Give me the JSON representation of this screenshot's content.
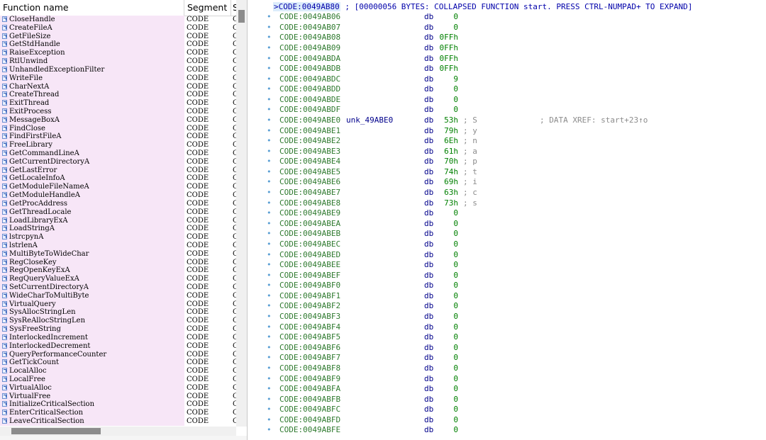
{
  "functions_window": {
    "columns": [
      "Function name",
      "Segment",
      "S"
    ],
    "rows": [
      {
        "name": "CloseHandle",
        "segment": "CODE",
        "extra": "C"
      },
      {
        "name": "CreateFileA",
        "segment": "CODE",
        "extra": "C"
      },
      {
        "name": "GetFileSize",
        "segment": "CODE",
        "extra": "C"
      },
      {
        "name": "GetStdHandle",
        "segment": "CODE",
        "extra": "C"
      },
      {
        "name": "RaiseException",
        "segment": "CODE",
        "extra": "C"
      },
      {
        "name": "RtlUnwind",
        "segment": "CODE",
        "extra": "C"
      },
      {
        "name": "UnhandledExceptionFilter",
        "segment": "CODE",
        "extra": "C"
      },
      {
        "name": "WriteFile",
        "segment": "CODE",
        "extra": "C"
      },
      {
        "name": "CharNextA",
        "segment": "CODE",
        "extra": "C"
      },
      {
        "name": "CreateThread",
        "segment": "CODE",
        "extra": "C"
      },
      {
        "name": "ExitThread",
        "segment": "CODE",
        "extra": "C"
      },
      {
        "name": "ExitProcess",
        "segment": "CODE",
        "extra": "C"
      },
      {
        "name": "MessageBoxA",
        "segment": "CODE",
        "extra": "C"
      },
      {
        "name": "FindClose",
        "segment": "CODE",
        "extra": "C"
      },
      {
        "name": "FindFirstFileA",
        "segment": "CODE",
        "extra": "C"
      },
      {
        "name": "FreeLibrary",
        "segment": "CODE",
        "extra": "C"
      },
      {
        "name": "GetCommandLineA",
        "segment": "CODE",
        "extra": "C"
      },
      {
        "name": "GetCurrentDirectoryA",
        "segment": "CODE",
        "extra": "C"
      },
      {
        "name": "GetLastError",
        "segment": "CODE",
        "extra": "C"
      },
      {
        "name": "GetLocaleInfoA",
        "segment": "CODE",
        "extra": "C"
      },
      {
        "name": "GetModuleFileNameA",
        "segment": "CODE",
        "extra": "C"
      },
      {
        "name": "GetModuleHandleA",
        "segment": "CODE",
        "extra": "C"
      },
      {
        "name": "GetProcAddress",
        "segment": "CODE",
        "extra": "C"
      },
      {
        "name": "GetThreadLocale",
        "segment": "CODE",
        "extra": "C"
      },
      {
        "name": "LoadLibraryExA",
        "segment": "CODE",
        "extra": "C"
      },
      {
        "name": "LoadStringA",
        "segment": "CODE",
        "extra": "C"
      },
      {
        "name": "lstrcpynA",
        "segment": "CODE",
        "extra": "C"
      },
      {
        "name": "lstrlenA",
        "segment": "CODE",
        "extra": "C"
      },
      {
        "name": "MultiByteToWideChar",
        "segment": "CODE",
        "extra": "C"
      },
      {
        "name": "RegCloseKey",
        "segment": "CODE",
        "extra": "C"
      },
      {
        "name": "RegOpenKeyExA",
        "segment": "CODE",
        "extra": "C"
      },
      {
        "name": "RegQueryValueExA",
        "segment": "CODE",
        "extra": "C"
      },
      {
        "name": "SetCurrentDirectoryA",
        "segment": "CODE",
        "extra": "C"
      },
      {
        "name": "WideCharToMultiByte",
        "segment": "CODE",
        "extra": "C"
      },
      {
        "name": "VirtualQuery",
        "segment": "CODE",
        "extra": "C"
      },
      {
        "name": "SysAllocStringLen",
        "segment": "CODE",
        "extra": "C"
      },
      {
        "name": "SysReAllocStringLen",
        "segment": "CODE",
        "extra": "C"
      },
      {
        "name": "SysFreeString",
        "segment": "CODE",
        "extra": "C"
      },
      {
        "name": "InterlockedIncrement",
        "segment": "CODE",
        "extra": "C"
      },
      {
        "name": "InterlockedDecrement",
        "segment": "CODE",
        "extra": "C"
      },
      {
        "name": "QueryPerformanceCounter",
        "segment": "CODE",
        "extra": "C"
      },
      {
        "name": "GetTickCount",
        "segment": "CODE",
        "extra": "C"
      },
      {
        "name": "LocalAlloc",
        "segment": "CODE",
        "extra": "C"
      },
      {
        "name": "LocalFree",
        "segment": "CODE",
        "extra": "C"
      },
      {
        "name": "VirtualAlloc",
        "segment": "CODE",
        "extra": "C"
      },
      {
        "name": "VirtualFree",
        "segment": "CODE",
        "extra": "C"
      },
      {
        "name": "InitializeCriticalSection",
        "segment": "CODE",
        "extra": "C"
      },
      {
        "name": "EnterCriticalSection",
        "segment": "CODE",
        "extra": "C"
      },
      {
        "name": "LeaveCriticalSection",
        "segment": "CODE",
        "extra": "C"
      }
    ],
    "row_icon": "function-icon"
  },
  "disassembly": {
    "collapsed_line": {
      "marker": ">",
      "address": "CODE:0049AB80",
      "text": " ; [00000056 BYTES: COLLAPSED FUNCTION start. PRESS CTRL-NUMPAD+ TO EXPAND]"
    },
    "lines": [
      {
        "addr": "CODE:0049AB06",
        "label": "",
        "mnemonic": "db",
        "value": "0",
        "comment": "",
        "xref": ""
      },
      {
        "addr": "CODE:0049AB07",
        "label": "",
        "mnemonic": "db",
        "value": "0",
        "comment": "",
        "xref": ""
      },
      {
        "addr": "CODE:0049AB08",
        "label": "",
        "mnemonic": "db",
        "value": "0FFh",
        "comment": "",
        "xref": ""
      },
      {
        "addr": "CODE:0049AB09",
        "label": "",
        "mnemonic": "db",
        "value": "0FFh",
        "comment": "",
        "xref": ""
      },
      {
        "addr": "CODE:0049ABDA",
        "label": "",
        "mnemonic": "db",
        "value": "0FFh",
        "comment": "",
        "xref": ""
      },
      {
        "addr": "CODE:0049ABDB",
        "label": "",
        "mnemonic": "db",
        "value": "0FFh",
        "comment": "",
        "xref": ""
      },
      {
        "addr": "CODE:0049ABDC",
        "label": "",
        "mnemonic": "db",
        "value": "9",
        "comment": "",
        "xref": ""
      },
      {
        "addr": "CODE:0049ABDD",
        "label": "",
        "mnemonic": "db",
        "value": "0",
        "comment": "",
        "xref": ""
      },
      {
        "addr": "CODE:0049ABDE",
        "label": "",
        "mnemonic": "db",
        "value": "0",
        "comment": "",
        "xref": ""
      },
      {
        "addr": "CODE:0049ABDF",
        "label": "",
        "mnemonic": "db",
        "value": "0",
        "comment": "",
        "xref": ""
      },
      {
        "addr": "CODE:0049ABE0",
        "label": "unk_49ABE0",
        "mnemonic": "db",
        "value": "53h",
        "comment": "; S",
        "xref": "; DATA XREF: start+23↑o"
      },
      {
        "addr": "CODE:0049ABE1",
        "label": "",
        "mnemonic": "db",
        "value": "79h",
        "comment": "; y",
        "xref": ""
      },
      {
        "addr": "CODE:0049ABE2",
        "label": "",
        "mnemonic": "db",
        "value": "6Eh",
        "comment": "; n",
        "xref": ""
      },
      {
        "addr": "CODE:0049ABE3",
        "label": "",
        "mnemonic": "db",
        "value": "61h",
        "comment": "; a",
        "xref": ""
      },
      {
        "addr": "CODE:0049ABE4",
        "label": "",
        "mnemonic": "db",
        "value": "70h",
        "comment": "; p",
        "xref": ""
      },
      {
        "addr": "CODE:0049ABE5",
        "label": "",
        "mnemonic": "db",
        "value": "74h",
        "comment": "; t",
        "xref": ""
      },
      {
        "addr": "CODE:0049ABE6",
        "label": "",
        "mnemonic": "db",
        "value": "69h",
        "comment": "; i",
        "xref": ""
      },
      {
        "addr": "CODE:0049ABE7",
        "label": "",
        "mnemonic": "db",
        "value": "63h",
        "comment": "; c",
        "xref": ""
      },
      {
        "addr": "CODE:0049ABE8",
        "label": "",
        "mnemonic": "db",
        "value": "73h",
        "comment": "; s",
        "xref": ""
      },
      {
        "addr": "CODE:0049ABE9",
        "label": "",
        "mnemonic": "db",
        "value": "0",
        "comment": "",
        "xref": ""
      },
      {
        "addr": "CODE:0049ABEA",
        "label": "",
        "mnemonic": "db",
        "value": "0",
        "comment": "",
        "xref": ""
      },
      {
        "addr": "CODE:0049ABEB",
        "label": "",
        "mnemonic": "db",
        "value": "0",
        "comment": "",
        "xref": ""
      },
      {
        "addr": "CODE:0049ABEC",
        "label": "",
        "mnemonic": "db",
        "value": "0",
        "comment": "",
        "xref": ""
      },
      {
        "addr": "CODE:0049ABED",
        "label": "",
        "mnemonic": "db",
        "value": "0",
        "comment": "",
        "xref": ""
      },
      {
        "addr": "CODE:0049ABEE",
        "label": "",
        "mnemonic": "db",
        "value": "0",
        "comment": "",
        "xref": ""
      },
      {
        "addr": "CODE:0049ABEF",
        "label": "",
        "mnemonic": "db",
        "value": "0",
        "comment": "",
        "xref": ""
      },
      {
        "addr": "CODE:0049ABF0",
        "label": "",
        "mnemonic": "db",
        "value": "0",
        "comment": "",
        "xref": ""
      },
      {
        "addr": "CODE:0049ABF1",
        "label": "",
        "mnemonic": "db",
        "value": "0",
        "comment": "",
        "xref": ""
      },
      {
        "addr": "CODE:0049ABF2",
        "label": "",
        "mnemonic": "db",
        "value": "0",
        "comment": "",
        "xref": ""
      },
      {
        "addr": "CODE:0049ABF3",
        "label": "",
        "mnemonic": "db",
        "value": "0",
        "comment": "",
        "xref": ""
      },
      {
        "addr": "CODE:0049ABF4",
        "label": "",
        "mnemonic": "db",
        "value": "0",
        "comment": "",
        "xref": ""
      },
      {
        "addr": "CODE:0049ABF5",
        "label": "",
        "mnemonic": "db",
        "value": "0",
        "comment": "",
        "xref": ""
      },
      {
        "addr": "CODE:0049ABF6",
        "label": "",
        "mnemonic": "db",
        "value": "0",
        "comment": "",
        "xref": ""
      },
      {
        "addr": "CODE:0049ABF7",
        "label": "",
        "mnemonic": "db",
        "value": "0",
        "comment": "",
        "xref": ""
      },
      {
        "addr": "CODE:0049ABF8",
        "label": "",
        "mnemonic": "db",
        "value": "0",
        "comment": "",
        "xref": ""
      },
      {
        "addr": "CODE:0049ABF9",
        "label": "",
        "mnemonic": "db",
        "value": "0",
        "comment": "",
        "xref": ""
      },
      {
        "addr": "CODE:0049ABFA",
        "label": "",
        "mnemonic": "db",
        "value": "0",
        "comment": "",
        "xref": ""
      },
      {
        "addr": "CODE:0049ABFB",
        "label": "",
        "mnemonic": "db",
        "value": "0",
        "comment": "",
        "xref": ""
      },
      {
        "addr": "CODE:0049ABFC",
        "label": "",
        "mnemonic": "db",
        "value": "0",
        "comment": "",
        "xref": ""
      },
      {
        "addr": "CODE:0049ABFD",
        "label": "",
        "mnemonic": "db",
        "value": "0",
        "comment": "",
        "xref": ""
      },
      {
        "addr": "CODE:0049ABFE",
        "label": "",
        "mnemonic": "db",
        "value": "0",
        "comment": "",
        "xref": ""
      }
    ],
    "bullet": "•"
  },
  "colors": {
    "function_row_bg": "#f7e6f7",
    "address": "#2f7a2f",
    "mnemonic": "#00008b",
    "value": "#008000",
    "comment": "#8c8c8c",
    "collapsed_text": "#0000aa"
  }
}
